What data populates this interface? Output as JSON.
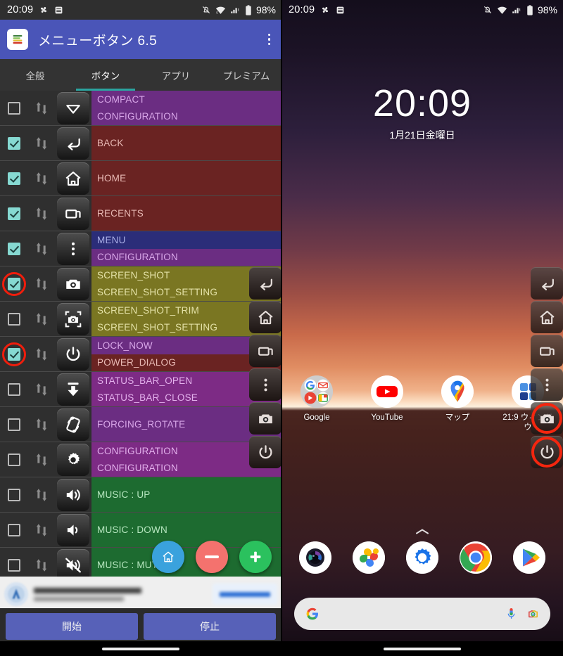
{
  "left_phone": {
    "status_bar": {
      "time": "20:09",
      "battery_text": "98%",
      "icons": [
        "pinwheel-icon",
        "list-icon",
        "notifications-muted-icon",
        "wifi-icon",
        "signal-icon",
        "battery-icon"
      ]
    },
    "app_bar": {
      "title": "メニューボタン 6.5",
      "logo_icon": "app-logo-icon",
      "overflow_icon": "overflow-menu-icon"
    },
    "tabs": [
      {
        "label": "全般",
        "active": false
      },
      {
        "label": "ボタン",
        "active": true
      },
      {
        "label": "アプリ",
        "active": false
      },
      {
        "label": "プレミアム",
        "active": false
      }
    ],
    "accent_color": "#2ba5a0",
    "appbar_color": "#4a55b8",
    "annotation_color": "#f4260f",
    "rows": [
      {
        "checked": false,
        "annotated": false,
        "icon": "chevron-down-icon",
        "primary": "COMPACT",
        "primary_bg": "#6b2d82",
        "primary_fg": "#d8a6e8",
        "secondary": "CONFIGURATION",
        "secondary_bg": "#6b2d82",
        "secondary_fg": "#d8a6e8"
      },
      {
        "checked": true,
        "annotated": false,
        "icon": "back-arrow-icon",
        "primary": "BACK",
        "primary_bg": "#6a2322",
        "primary_fg": "#e8b9b4",
        "secondary": "",
        "secondary_bg": "#6a2322",
        "secondary_fg": "#e8b9b4"
      },
      {
        "checked": true,
        "annotated": false,
        "icon": "home-icon",
        "primary": "HOME",
        "primary_bg": "#6a2322",
        "primary_fg": "#e8b9b4",
        "secondary": "",
        "secondary_bg": "#6a2322",
        "secondary_fg": "#e8b9b4"
      },
      {
        "checked": true,
        "annotated": false,
        "icon": "recents-icon",
        "primary": "RECENTS",
        "primary_bg": "#6a2322",
        "primary_fg": "#e8b9b4",
        "secondary": "",
        "secondary_bg": "#6a2322",
        "secondary_fg": "#e8b9b4"
      },
      {
        "checked": true,
        "annotated": false,
        "icon": "menu-dots-icon",
        "primary": "MENU",
        "primary_bg": "#2b2d79",
        "primary_fg": "#a9aee6",
        "secondary": "CONFIGURATION",
        "secondary_bg": "#6b2d82",
        "secondary_fg": "#d8a6e8"
      },
      {
        "checked": true,
        "annotated": true,
        "icon": "camera-icon",
        "primary": "SCREEN_SHOT",
        "primary_bg": "#7a7622",
        "primary_fg": "#e4e2a8",
        "secondary": "SCREEN_SHOT_SETTING",
        "secondary_bg": "#7a7622",
        "secondary_fg": "#e4e2a8"
      },
      {
        "checked": false,
        "annotated": false,
        "icon": "camera-crop-icon",
        "primary": "SCREEN_SHOT_TRIM",
        "primary_bg": "#7a7622",
        "primary_fg": "#e4e2a8",
        "secondary": "SCREEN_SHOT_SETTING",
        "secondary_bg": "#7a7622",
        "secondary_fg": "#e4e2a8"
      },
      {
        "checked": true,
        "annotated": true,
        "icon": "power-icon",
        "primary": "LOCK_NOW",
        "primary_bg": "#6b2d82",
        "primary_fg": "#d8a6e8",
        "secondary": "POWER_DIALOG",
        "secondary_bg": "#6a2322",
        "secondary_fg": "#e8b9b4"
      },
      {
        "checked": false,
        "annotated": false,
        "icon": "status-bar-open-icon",
        "primary": "STATUS_BAR_OPEN",
        "primary_bg": "#7d2b85",
        "primary_fg": "#e3b0ec",
        "secondary": "STATUS_BAR_CLOSE",
        "secondary_bg": "#7d2b85",
        "secondary_fg": "#e3b0ec"
      },
      {
        "checked": false,
        "annotated": false,
        "icon": "rotate-icon",
        "primary": "FORCING_ROTATE",
        "primary_bg": "#6b2d82",
        "primary_fg": "#d8a6e8",
        "secondary": "",
        "secondary_bg": "#6b2d82",
        "secondary_fg": "#d8a6e8"
      },
      {
        "checked": false,
        "annotated": false,
        "icon": "gear-icon",
        "primary": "CONFIGURATION",
        "primary_bg": "#7d2b85",
        "primary_fg": "#e3b0ec",
        "secondary": "CONFIGURATION",
        "secondary_bg": "#7d2b85",
        "secondary_fg": "#e3b0ec"
      },
      {
        "checked": false,
        "annotated": false,
        "icon": "volume-up-icon",
        "primary": "MUSIC : UP",
        "primary_bg": "#1d6b30",
        "primary_fg": "#b6e6bf",
        "secondary": "",
        "secondary_bg": "#1d6b30",
        "secondary_fg": "#b6e6bf"
      },
      {
        "checked": false,
        "annotated": false,
        "icon": "volume-down-icon",
        "primary": "MUSIC : DOWN",
        "primary_bg": "#1d6b30",
        "primary_fg": "#b6e6bf",
        "secondary": "",
        "secondary_bg": "#1d6b30",
        "secondary_fg": "#b6e6bf"
      },
      {
        "checked": false,
        "annotated": false,
        "icon": "volume-mute-icon",
        "primary": "MUSIC : MUTE",
        "primary_bg": "#1d6b30",
        "primary_fg": "#b6e6bf",
        "secondary": "",
        "secondary_bg": "#1d6b30",
        "secondary_fg": "#b6e6bf"
      }
    ],
    "fabs": [
      {
        "name": "home-fab",
        "icon": "home-icon",
        "color": "#3aa2dd"
      },
      {
        "name": "remove-fab",
        "icon": "minus-icon",
        "color": "#f4726e"
      },
      {
        "name": "add-fab",
        "icon": "plus-icon",
        "color": "#2bc15e"
      }
    ],
    "bottom_buttons": [
      {
        "label": "開始",
        "name": "start-button"
      },
      {
        "label": "停止",
        "name": "stop-button"
      }
    ],
    "overlay_buttons": [
      {
        "icon": "back-arrow-icon",
        "annotated": false
      },
      {
        "icon": "home-icon",
        "annotated": false
      },
      {
        "icon": "recents-icon",
        "annotated": false
      },
      {
        "icon": "menu-dots-icon",
        "annotated": false
      },
      {
        "icon": "camera-icon",
        "annotated": false
      },
      {
        "icon": "power-icon",
        "annotated": false
      }
    ]
  },
  "right_phone": {
    "status_bar": {
      "time": "20:09",
      "battery_text": "98%"
    },
    "clock": {
      "time": "20:09",
      "date": "1月21日金曜日"
    },
    "apps": [
      {
        "label": "Google",
        "icon": "google-folder-icon"
      },
      {
        "label": "YouTube",
        "icon": "youtube-icon"
      },
      {
        "label": "マップ",
        "icon": "google-maps-icon"
      },
      {
        "label": "21:9 ウィンドウ",
        "icon": "multi-window-icon"
      }
    ],
    "dock": [
      {
        "icon": "camera-icon"
      },
      {
        "icon": "google-photos-icon"
      },
      {
        "icon": "settings-gear-icon"
      },
      {
        "icon": "chrome-icon"
      },
      {
        "icon": "play-store-icon"
      }
    ],
    "search": {
      "logo_icon": "google-g-icon",
      "mic_icon": "microphone-icon",
      "lens_icon": "google-lens-icon"
    },
    "page_up_icon": "chevron-up-icon",
    "overlay_buttons": [
      {
        "icon": "back-arrow-icon",
        "annotated": false
      },
      {
        "icon": "home-icon",
        "annotated": false
      },
      {
        "icon": "recents-icon",
        "annotated": false
      },
      {
        "icon": "menu-dots-icon",
        "annotated": false
      },
      {
        "icon": "camera-icon",
        "annotated": true
      },
      {
        "icon": "power-icon",
        "annotated": true
      }
    ]
  }
}
